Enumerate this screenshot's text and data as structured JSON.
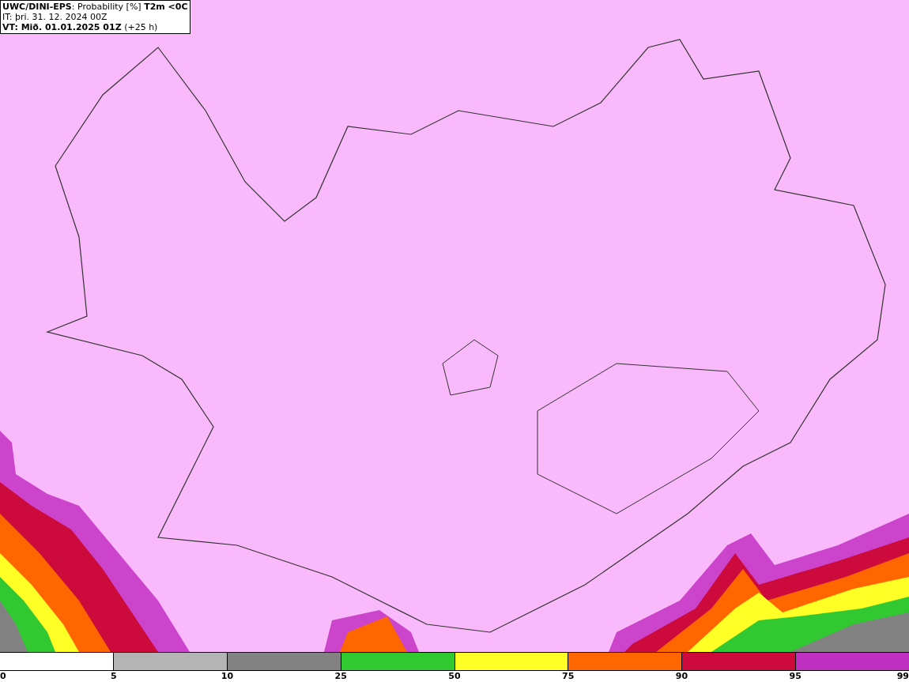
{
  "title_box": {
    "lines": [
      "**UWC/DINI-EPS**: Probability [%] **T2m <0C**",
      "IT: þri. 31. 12. 2024 00Z",
      "**VT: Mið. 01.01.2025 01Z** (+25 h)"
    ]
  },
  "legend": {
    "segments": [
      {
        "color": "#ffffff"
      },
      {
        "color": "#b4b4b4"
      },
      {
        "color": "#828282"
      },
      {
        "color": "#32c832"
      },
      {
        "color": "#ffff28"
      },
      {
        "color": "#ff6600"
      },
      {
        "color": "#cc0a3c"
      },
      {
        "color": "#c030c0"
      }
    ],
    "ticks": [
      "0",
      "5",
      "10",
      "25",
      "50",
      "75",
      "90",
      "95",
      "99"
    ]
  }
}
